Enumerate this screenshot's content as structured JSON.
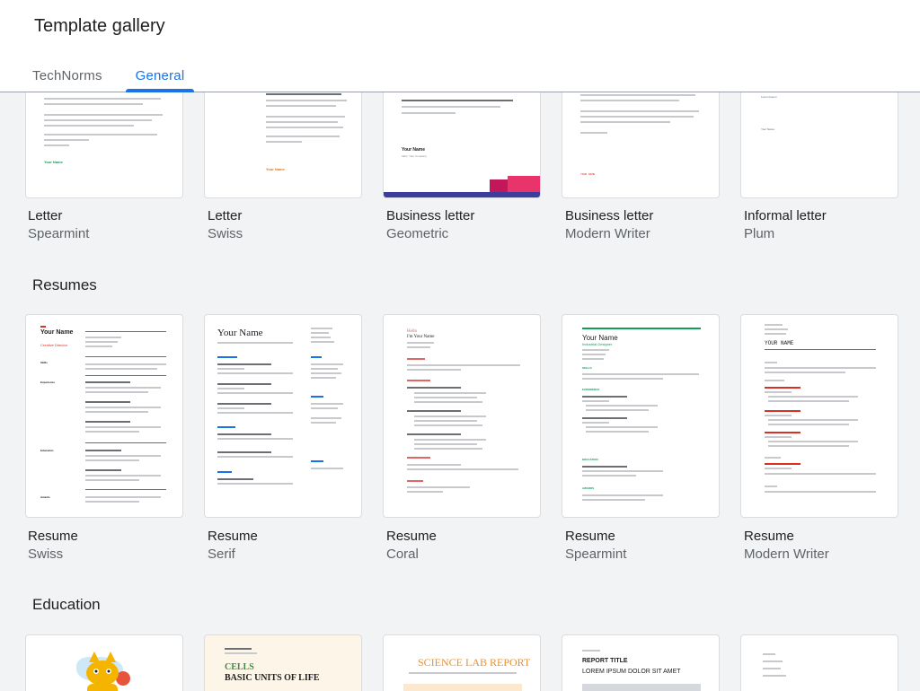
{
  "header": {
    "title": "Template gallery",
    "tabs": [
      {
        "label": "TechNorms",
        "active": false
      },
      {
        "label": "General",
        "active": true
      }
    ]
  },
  "sections": {
    "resumes_title": "Resumes",
    "education_title": "Education"
  },
  "letters": [
    {
      "name": "Letter",
      "style": "Spearmint",
      "thumb_text": "Your Name"
    },
    {
      "name": "Letter",
      "style": "Swiss",
      "thumb_text": "Your Name"
    },
    {
      "name": "Business letter",
      "style": "Geometric",
      "thumb_text": "Your Name",
      "thumb_sub": "CEO, Your Company"
    },
    {
      "name": "Business letter",
      "style": "Modern Writer",
      "thumb_text": "YOUR NAME"
    },
    {
      "name": "Informal letter",
      "style": "Plum",
      "thumb_text": "Lorem Ipsum",
      "thumb_sub": "Your Name"
    }
  ],
  "resumes": [
    {
      "name": "Resume",
      "style": "Swiss",
      "thumb_title": "Your Name",
      "thumb_role": "Creative Director",
      "thumb_sections": [
        "Skills",
        "Experience",
        "Education",
        "Awards"
      ]
    },
    {
      "name": "Resume",
      "style": "Serif",
      "thumb_title": "Your Name"
    },
    {
      "name": "Resume",
      "style": "Coral",
      "thumb_title": "Hello",
      "thumb_sub": "I'm Your Name"
    },
    {
      "name": "Resume",
      "style": "Spearmint",
      "thumb_title": "Your Name",
      "thumb_role": "Industrial Designer",
      "thumb_sections": [
        "SKILLS",
        "EXPERIENCE",
        "EDUCATION",
        "AWARDS"
      ]
    },
    {
      "name": "Resume",
      "style": "Modern Writer",
      "thumb_title": "YOUR NAME"
    }
  ],
  "education": [
    {
      "name": "",
      "style": ""
    },
    {
      "name": "",
      "style": "",
      "thumb_title": "CELLS",
      "thumb_sub": "BASIC UNITS OF LIFE"
    },
    {
      "name": "",
      "style": "",
      "thumb_title": "SCIENCE LAB REPORT"
    },
    {
      "name": "",
      "style": "",
      "thumb_title": "REPORT TITLE",
      "thumb_sub": "LOREM IPSUM DOLOR SIT AMET"
    },
    {
      "name": "",
      "style": ""
    }
  ],
  "colors": {
    "accent": "#1a73e8",
    "spearmint_green": "#0f9d58",
    "swiss_red": "#d93025",
    "coral": "#e06666",
    "geometric_navy": "#3d3d9e",
    "geometric_pink": "#e8336b",
    "science_orange": "#e69138"
  }
}
